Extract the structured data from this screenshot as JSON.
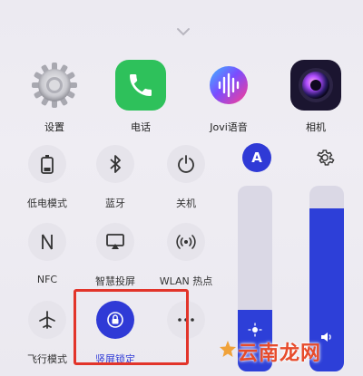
{
  "apps": [
    {
      "label": "设置",
      "icon": "settings-icon"
    },
    {
      "label": "电话",
      "icon": "phone-icon"
    },
    {
      "label": "Jovi语音",
      "icon": "jovi-voice-icon"
    },
    {
      "label": "相机",
      "icon": "camera-icon"
    }
  ],
  "tiles": [
    {
      "label": "低电模式",
      "icon": "battery-icon"
    },
    {
      "label": "蓝牙",
      "icon": "bluetooth-icon"
    },
    {
      "label": "关机",
      "icon": "power-icon"
    },
    {
      "label": "NFC",
      "icon": "nfc-icon"
    },
    {
      "label": "智慧投屏",
      "icon": "screen-cast-icon"
    },
    {
      "label": "WLAN 热点",
      "icon": "hotspot-icon"
    },
    {
      "label": "飞行模式",
      "icon": "airplane-icon"
    },
    {
      "label": "竖屏锁定",
      "icon": "portrait-lock-icon",
      "active": true
    },
    {
      "label": "",
      "icon": "more-icon"
    }
  ],
  "auto_brightness_label": "A",
  "brightness_level": 0.33,
  "volume_level": 0.88,
  "watermark": "云南龙网",
  "colors": {
    "accent": "#2f3ad6",
    "highlight": "#e2342a",
    "phone_green": "#2ec15b"
  }
}
